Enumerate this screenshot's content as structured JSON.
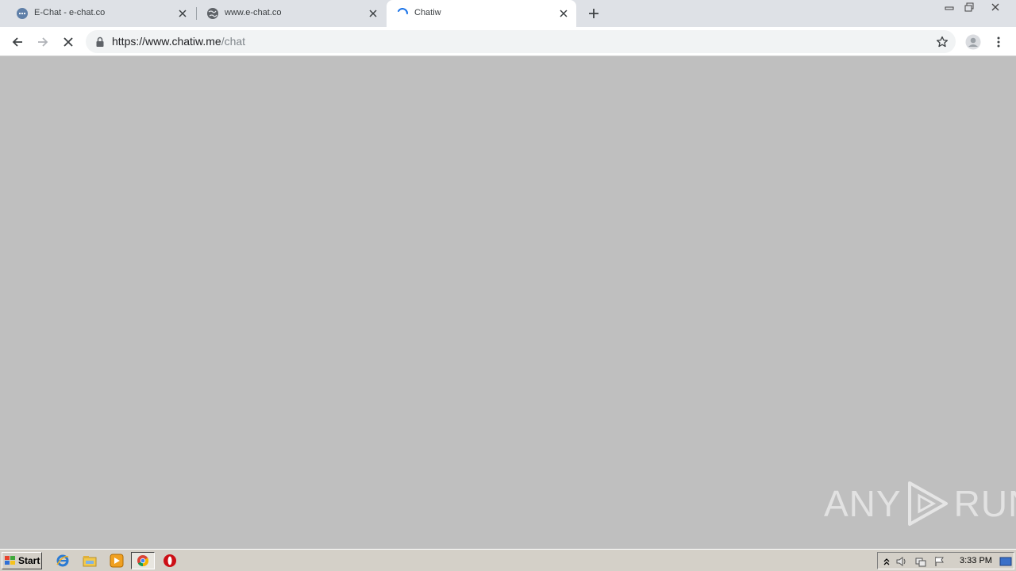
{
  "tabs": [
    {
      "title": "E-Chat - e-chat.co",
      "favicon": "dots-icon",
      "active": false
    },
    {
      "title": "www.e-chat.co",
      "favicon": "globe-icon",
      "active": false
    },
    {
      "title": "Chatiw",
      "favicon": "loading-spinner-icon",
      "active": true
    }
  ],
  "address_bar": {
    "url_host": "https://www.chatiw.me",
    "url_path": "/chat"
  },
  "watermark": {
    "left": "ANY",
    "right": "RUN"
  },
  "taskbar": {
    "start_label": "Start",
    "clock": "3:33 PM"
  },
  "colors": {
    "tabstrip": "#dee1e6",
    "page_bg": "#bfbfbf",
    "spinner": "#1a73e8",
    "taskbar": "#d4d0c8"
  }
}
